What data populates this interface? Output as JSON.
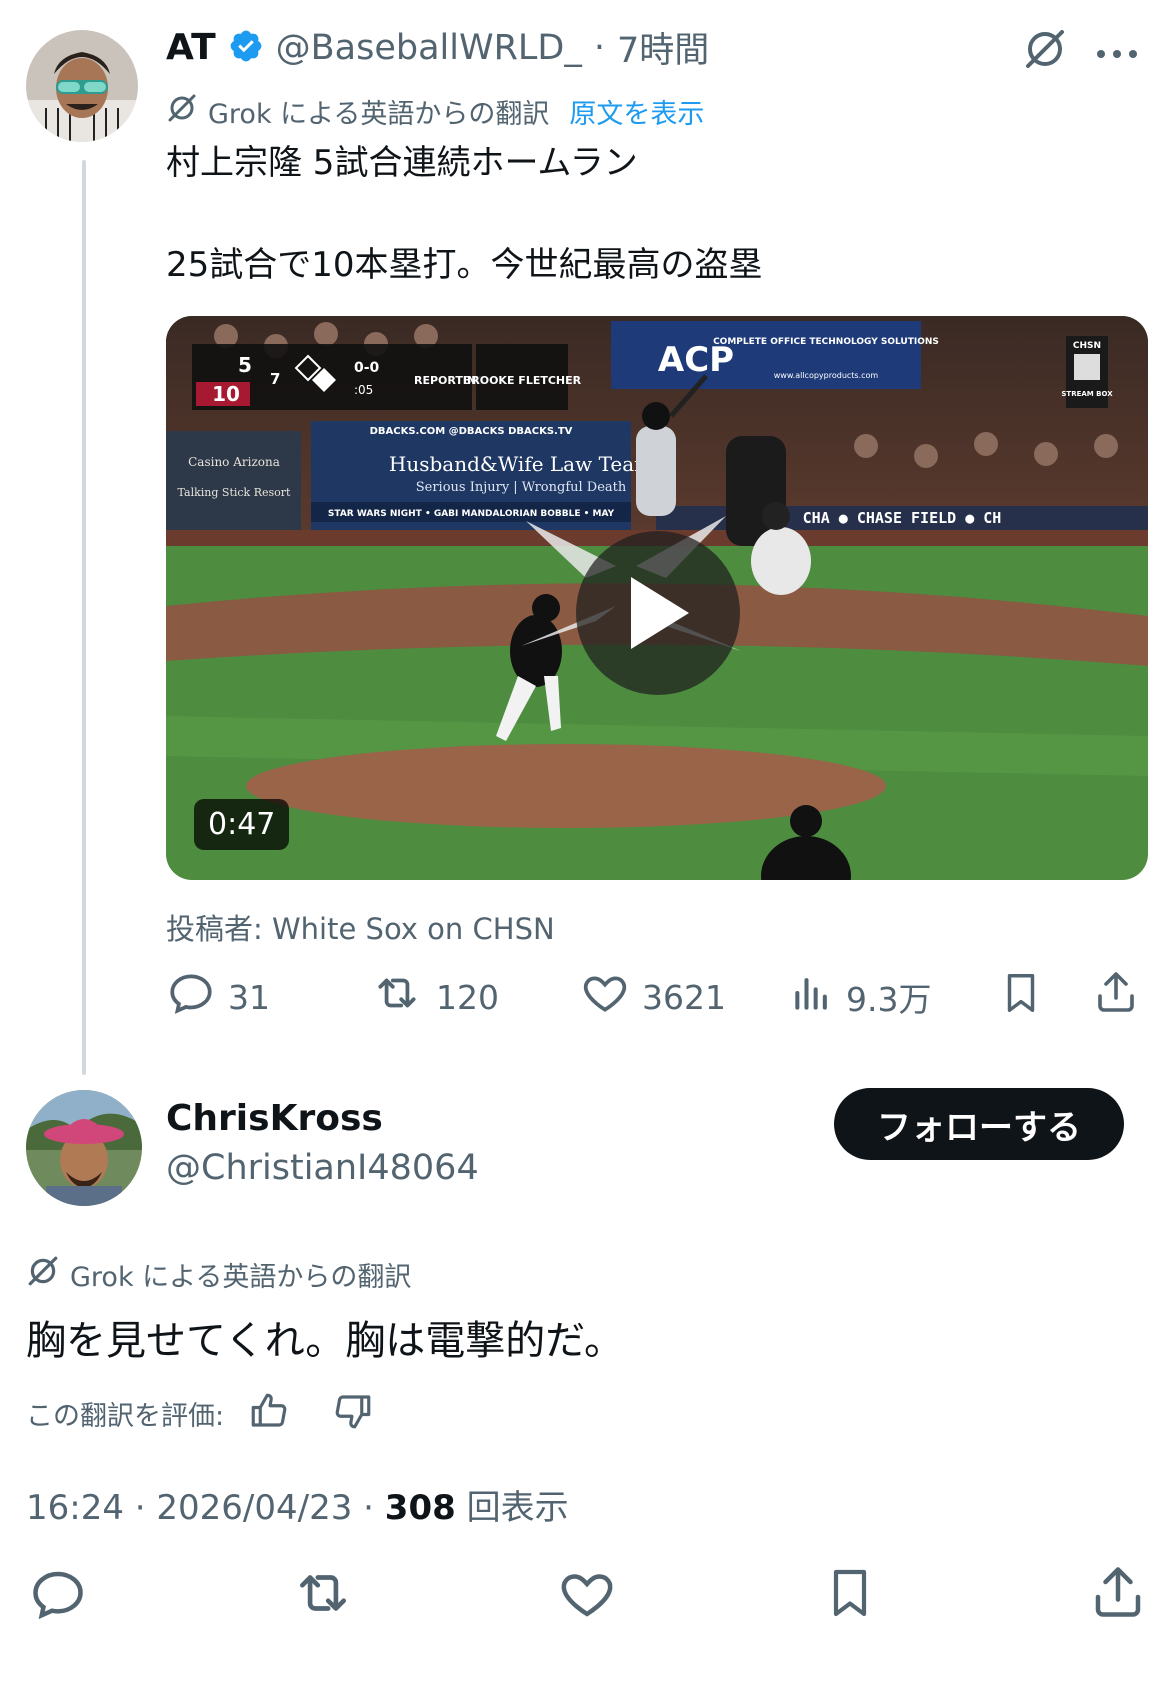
{
  "tweet": {
    "author_name": "AT",
    "author_handle": "@BaseballWRLD_",
    "time_sep": "·",
    "time": "7時間",
    "grok_label": "Grok による英語からの翻訳",
    "show_original": "原文を表示",
    "text_line1": "村上宗隆 5試合連続ホームラン",
    "text_line2": "25試合で10本塁打。今世紀最高の盗塁",
    "video": {
      "duration": "0:47",
      "scoreboard_away": "5",
      "scoreboard_home": "10",
      "inning": "7",
      "count": "0-0",
      "pitch_clock": ":05",
      "reporting": "REPORTING",
      "reporter": "BROOKE FLETCHER",
      "ad_left_1": "Casino Arizona",
      "ad_left_2": "Talking Stick Resort",
      "ad_center_top": "DBACKS.COM    @DBACKS    DBACKS.TV",
      "ad_center_title": "Husband&Wife Law Team",
      "ad_center_sub": "Serious Injury | Wrongful Death",
      "ad_center_ticker": "STAR WARS NIGHT • GABI MANDALORIAN BOBBLE • MAY",
      "ad_acp": "ACP",
      "ad_acp_side": "COMPLETE OFFICE TECHNOLOGY SOLUTIONS",
      "ad_acp_url": "www.allcopyproducts.com",
      "chase_field": "CHA    ● CHASE FIELD ● CH",
      "chsn": "CHSN",
      "stream_box": "STREAM BOX"
    },
    "source": "投稿者: White Sox on CHSN",
    "replies": "31",
    "retweets": "120",
    "likes": "3621",
    "views": "9.3万"
  },
  "reply": {
    "author_name": "ChrisKross",
    "author_handle": "@ChristianI48064",
    "follow_label": "フォローする",
    "grok_label": "Grok による英語からの翻訳",
    "text": "胸を見せてくれ。胸は電撃的だ。",
    "rate_label": "この翻訳を評価:",
    "meta_time": "16:24 · 2026/04/23 · ",
    "meta_views_count": "308",
    "meta_views_label": " 回表示"
  },
  "icons": [
    "verified-badge-icon",
    "grok-icon",
    "more-icon",
    "reply-icon",
    "retweet-icon",
    "like-icon",
    "views-icon",
    "bookmark-icon",
    "share-icon",
    "thumbs-up-icon",
    "thumbs-down-icon"
  ],
  "colors": {
    "accent": "#1d9bf0",
    "text": "#0f1419",
    "muted": "#536471",
    "line": "#cfd9de",
    "field": "#4d8a3e"
  }
}
